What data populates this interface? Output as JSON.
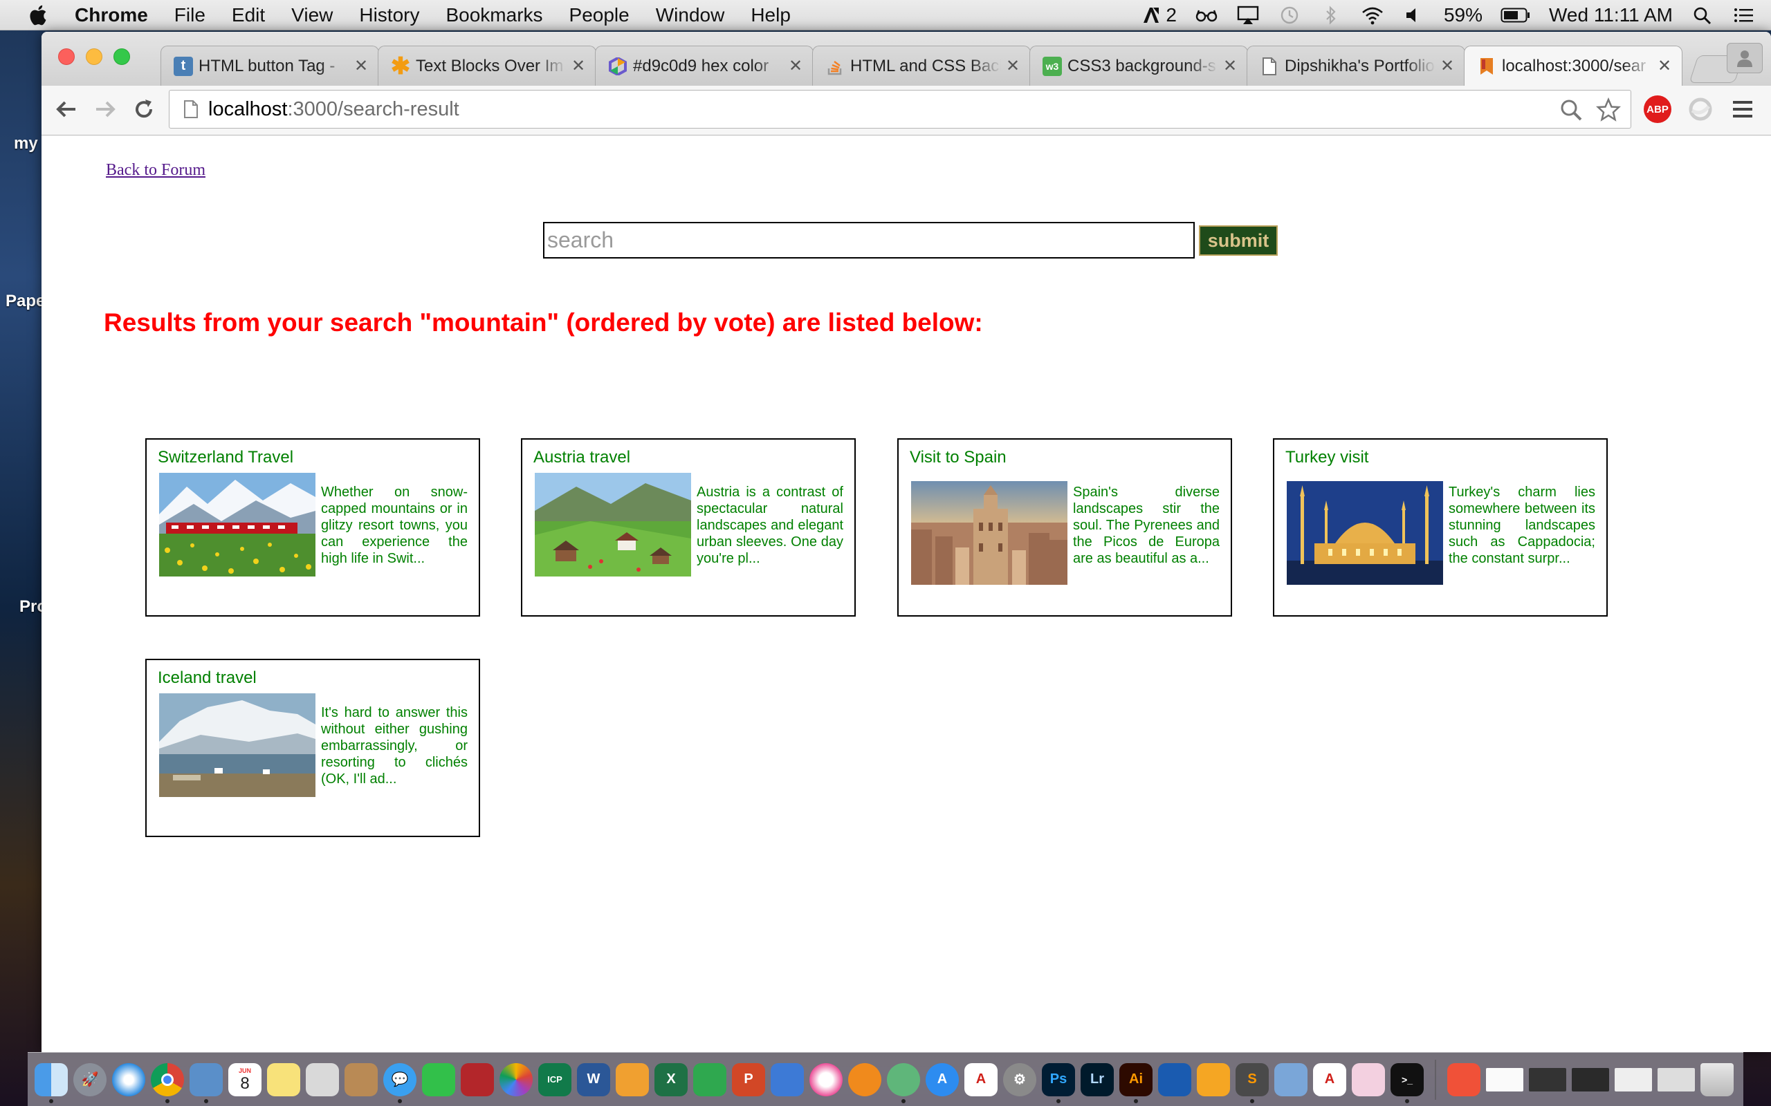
{
  "menubar": {
    "app_name": "Chrome",
    "menus": [
      "File",
      "Edit",
      "View",
      "History",
      "Bookmarks",
      "People",
      "Window",
      "Help"
    ],
    "status": {
      "notification_count": "2",
      "battery": "59%",
      "clock": "Wed 11:11 AM"
    }
  },
  "desktop": {
    "labels": [
      "my",
      "Pape",
      "Pro"
    ]
  },
  "browser": {
    "tabs": [
      {
        "title": "HTML button Tag - ",
        "favicon": "tutorial-site-icon",
        "color": "#4a7fb5"
      },
      {
        "title": "Text Blocks Over Im",
        "favicon": "asterisk-icon",
        "color": "#f39c12"
      },
      {
        "title": "#d9c0d9 hex color",
        "favicon": "color-hex-icon",
        "color": "#6a5acd"
      },
      {
        "title": "HTML and CSS Back",
        "favicon": "stack-overflow-icon",
        "color": "#f48024"
      },
      {
        "title": "CSS3 background-s",
        "favicon": "w3-icon",
        "color": "#4caf50"
      },
      {
        "title": "Dipshikha's Portfolio",
        "favicon": "document-icon",
        "color": "#888888"
      },
      {
        "title": "localhost:3000/sear",
        "favicon": "bookmark-page-icon",
        "color": "#e67e22"
      }
    ],
    "active_tab_index": 6,
    "address": {
      "host": "localhost",
      "path": ":3000/search-result"
    },
    "extension_label": "ABP"
  },
  "page": {
    "back_link": "Back to Forum",
    "search": {
      "placeholder": "search",
      "value": ""
    },
    "submit_label": "submit",
    "results_heading": "Results from your search \"mountain\" (ordered by vote) are listed below:",
    "results": [
      {
        "title": "Switzerland Travel",
        "description": "Whether on snow-capped mountains or in glitzy resort towns, you can experience the high life in Swit...",
        "image": "alpine-train-meadow-photo"
      },
      {
        "title": "Austria travel",
        "description": "Austria is a contrast of spectacular natural landscapes and elegant urban sleeves. One day you're pl...",
        "image": "green-valley-village-photo"
      },
      {
        "title": "Visit to Spain",
        "description": "Spain's diverse landscapes stir the soul. The Pyrenees and the Picos de Europa are as beautiful as a...",
        "image": "city-cathedral-sunset-photo"
      },
      {
        "title": "Turkey visit",
        "description": "Turkey's charm lies somewhere between its stunning landscapes such as Cappadocia; the constant surpr...",
        "image": "blue-mosque-night-photo"
      },
      {
        "title": "Iceland travel",
        "description": "It's hard to answer this without either gushing embarrassingly, or resorting to clichés (OK, I'll ad...",
        "image": "snowy-mountain-lake-photo"
      }
    ]
  },
  "dock": {
    "calendar_day": "8",
    "calendar_month": "JUN",
    "apps": [
      "finder-icon",
      "launchpad-icon",
      "safari-icon",
      "chrome-icon",
      "preview-icon",
      "calendar-icon",
      "notes-icon",
      "photos-viewer-icon",
      "contacts-icon",
      "messages-icon",
      "facetime-icon",
      "photo-booth-icon",
      "photos-icon",
      "icp-icon",
      "word-icon",
      "pages-icon",
      "excel-icon",
      "numbers-icon",
      "powerpoint-icon",
      "keynote-icon",
      "itunes-icon",
      "ibooks-icon",
      "atom-icon",
      "app-store-icon",
      "acrobat-icon",
      "system-preferences-icon",
      "photoshop-icon",
      "lightroom-icon",
      "illustrator-icon",
      "sourcetree-icon",
      "sketch-icon",
      "sublime-icon",
      "preview-app-icon",
      "acrobat-reader-icon",
      "flower-app-icon",
      "terminal-icon",
      "swift-icon",
      "window-thumb-1",
      "window-thumb-2",
      "window-thumb-3",
      "window-thumb-4",
      "window-thumb-5",
      "trash-icon"
    ]
  }
}
